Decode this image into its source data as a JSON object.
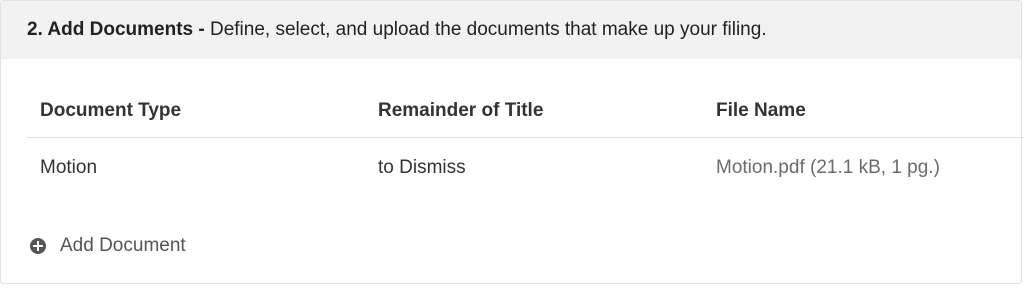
{
  "section": {
    "step_label": "2. Add Documents -",
    "description": "Define, select, and upload the documents that make up your filing."
  },
  "table": {
    "headers": {
      "document_type": "Document Type",
      "remainder_of_title": "Remainder of Title",
      "file_name": "File Name"
    },
    "rows": [
      {
        "document_type": "Motion",
        "remainder_of_title": "to Dismiss",
        "file_name": "Motion.pdf (21.1 kB, 1 pg.)"
      }
    ]
  },
  "actions": {
    "add_document_label": "Add Document",
    "add_document_icon": "plus-circle-icon"
  }
}
